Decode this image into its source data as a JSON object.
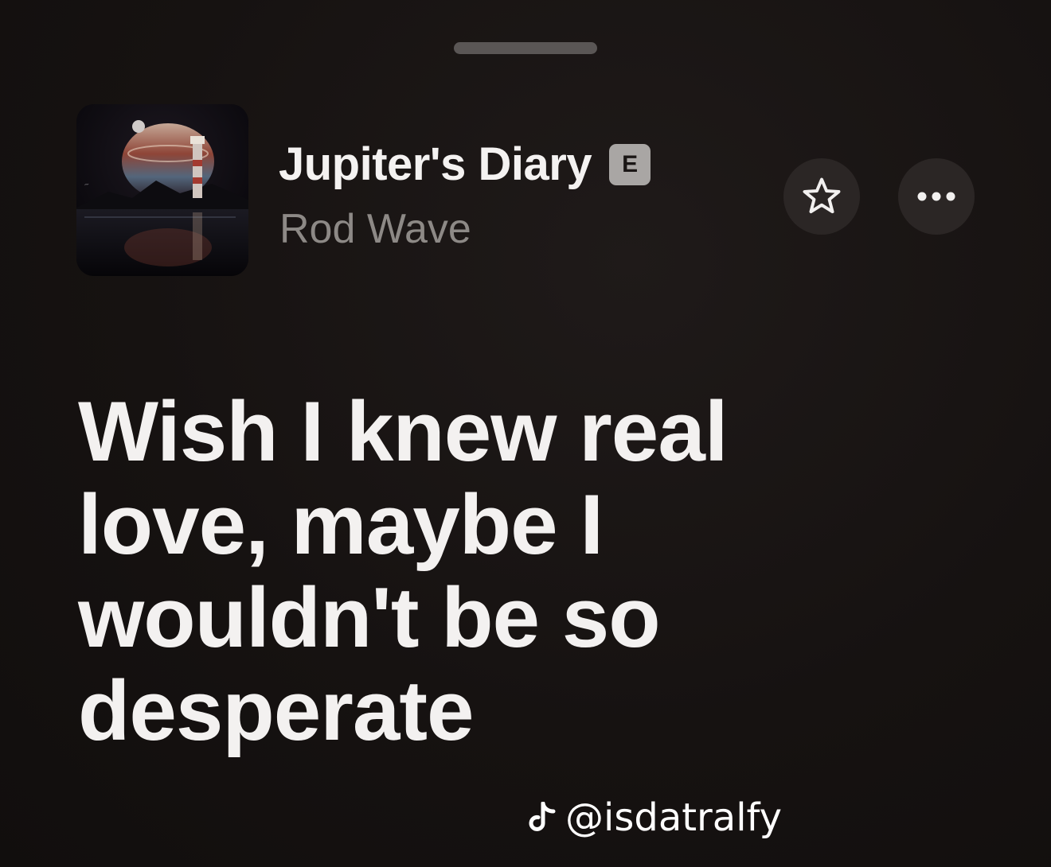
{
  "track": {
    "title": "Jupiter's Diary",
    "explicit_badge": "E",
    "artist": "Rod Wave"
  },
  "artwork": {
    "description_icon": "album-artwork"
  },
  "actions": {
    "favorite_icon": "star-icon",
    "more_icon": "ellipsis-icon"
  },
  "lyrics": {
    "lines": [
      "Wish I knew real",
      "love, maybe I",
      "wouldn't be so",
      "desperate"
    ]
  },
  "watermark": {
    "icon": "tiktok-icon",
    "handle": "@isdatralfy"
  },
  "colors": {
    "background": "#161211",
    "text_primary": "#f4f2f1",
    "text_secondary": "#8d8986",
    "button_bg": "#2b2625"
  }
}
